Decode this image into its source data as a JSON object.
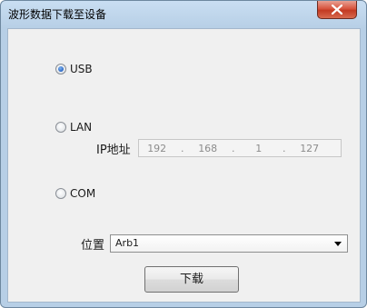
{
  "window": {
    "title": "波形数据下载至设备"
  },
  "connection": {
    "options": [
      {
        "label": "USB",
        "selected": true
      },
      {
        "label": "LAN",
        "selected": false
      },
      {
        "label": "COM",
        "selected": false
      }
    ]
  },
  "ip": {
    "label": "IP地址",
    "octets": [
      "192",
      "168",
      "1",
      "127"
    ],
    "separator": "."
  },
  "position": {
    "label": "位置",
    "value": "Arb1"
  },
  "download_button": "下载",
  "colors": {
    "close": "#c23a22",
    "accent": "#2a66c4"
  }
}
